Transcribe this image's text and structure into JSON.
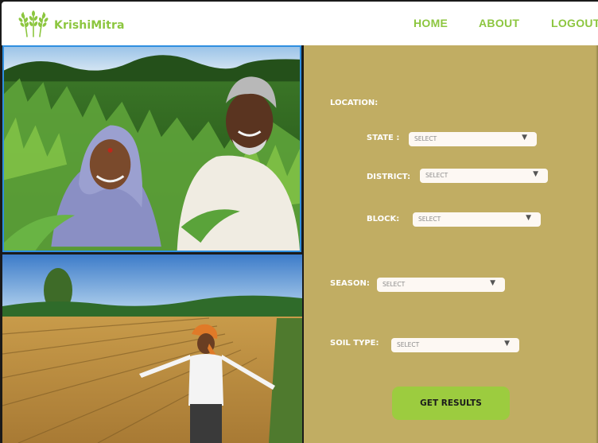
{
  "brand": {
    "name": "KrishiMitra",
    "logo_icon": "wheat-icon",
    "color": "#8cc63f"
  },
  "nav": {
    "home": "HOME",
    "about": "ABOUT",
    "logout": "LOGOUT"
  },
  "form": {
    "location_label": "LOCATION:",
    "state_label": "STATE :",
    "district_label": "DISTRICT:",
    "block_label": "BLOCK:",
    "season_label": "SEASON:",
    "soil_label": "SOIL TYPE:",
    "select_placeholder": "SELECT",
    "submit_label": "GET RESULTS"
  },
  "colors": {
    "panel": "#c1ad63",
    "button": "#9ccc3f",
    "selected_border": "#2f8fe0"
  }
}
